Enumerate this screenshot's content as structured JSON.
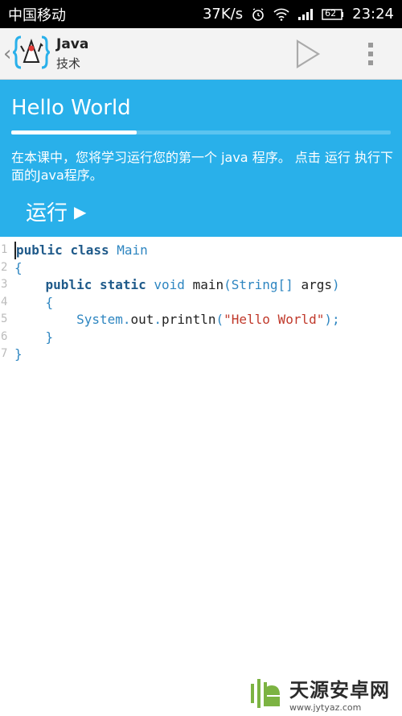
{
  "status": {
    "carrier": "中国移动",
    "speed": "37K/s",
    "battery": "62",
    "time": "23:24"
  },
  "app_bar": {
    "title": "Java",
    "subtitle": "技术"
  },
  "lesson": {
    "title": "Hello World",
    "progress": 0.33,
    "description": "在本课中，您将学习运行您的第一个 java 程序。 点击 运行 执行下面的Java程序。",
    "run_label": "运行"
  },
  "code": {
    "line_numbers": [
      "1",
      "2",
      "3",
      "4",
      "5",
      "6",
      "7"
    ],
    "kw_public": "public",
    "kw_class": "class",
    "class_name": "Main",
    "open_brace": "{",
    "close_brace": "}",
    "kw_static": "static",
    "kw_void": "void",
    "method": "main",
    "params_type": "String[]",
    "params_name": "args",
    "system": "System",
    "out": "out",
    "println": "println",
    "string_literal": "\"Hello World\"",
    "semicolon": ";"
  },
  "watermark": {
    "main": "天源安卓网",
    "sub": "www.jytyaz.com"
  },
  "colors": {
    "banner": "#29b0ea",
    "keyword": "#1f5a8a",
    "type": "#2e86c1",
    "string": "#c0392b"
  }
}
